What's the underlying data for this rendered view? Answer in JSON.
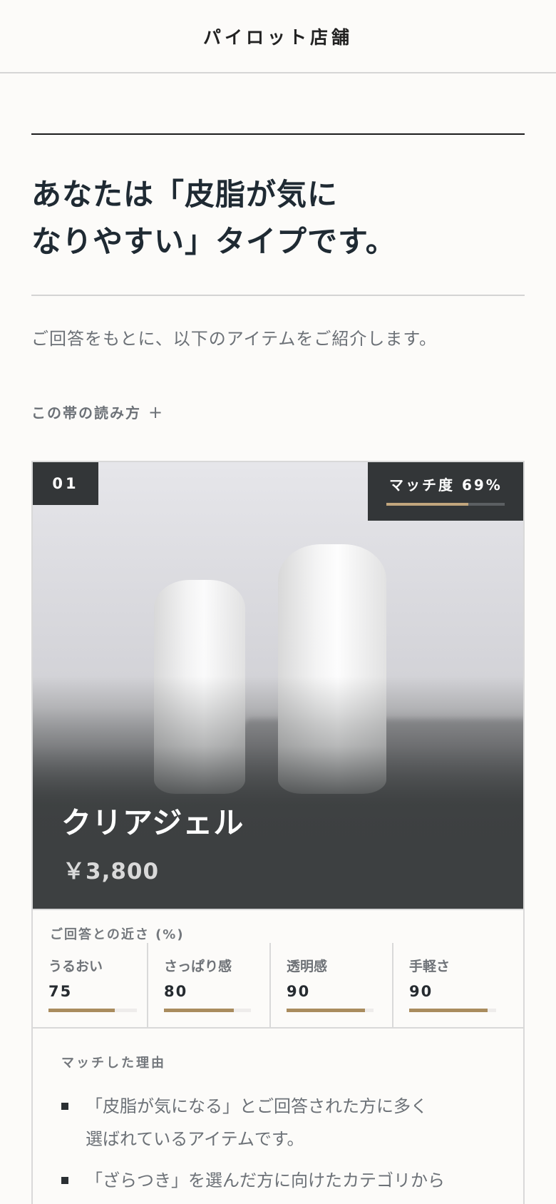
{
  "header": {
    "store_name": "パイロット店舗"
  },
  "result": {
    "title_line1": "あなたは「皮脂が気に",
    "title_line2": "なりやすい」タイプです。",
    "intro": "ご回答をもとに、以下のアイテムをご紹介します。",
    "howto_label": "この帯の読み方",
    "howto_plus": "+"
  },
  "product": {
    "rank": "01",
    "match_label": "マッチ度 69%",
    "match_value": 69,
    "name": "クリアジェル",
    "price": "￥3,800",
    "image_icon": "product-photo-bottles"
  },
  "attributes": {
    "title": "ご回答との近さ (%)",
    "items": [
      {
        "name": "うるおい",
        "value": "75"
      },
      {
        "name": "さっぱり感",
        "value": "80"
      },
      {
        "name": "透明感",
        "value": "90"
      },
      {
        "name": "手軽さ",
        "value": "90"
      }
    ]
  },
  "reasons": {
    "title": "マッチした理由",
    "items": [
      {
        "line1": "「皮脂が気になる」とご回答された方に多く",
        "line2": "選ばれているアイテムです。"
      },
      {
        "line1": "「ざらつき」を選んだ方に向けたカテゴリから",
        "line2": ""
      }
    ]
  },
  "colors": {
    "accent_gold": "#a98c5e",
    "dark_badge": "#333638",
    "background": "#fcfbf9"
  }
}
